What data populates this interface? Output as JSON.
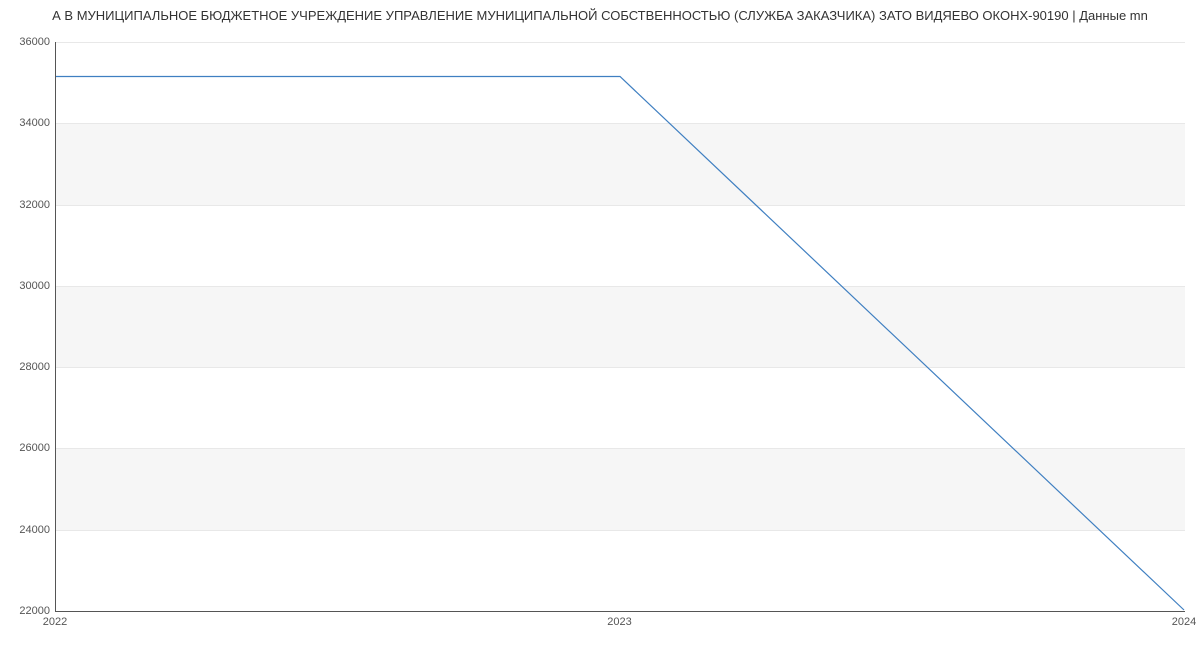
{
  "chart_data": {
    "type": "line",
    "title": "А В МУНИЦИПАЛЬНОЕ БЮДЖЕТНОЕ УЧРЕЖДЕНИЕ УПРАВЛЕНИЕ МУНИЦИПАЛЬНОЙ СОБСТВЕННОСТЬЮ (СЛУЖБА ЗАКАЗЧИКА) ЗАТО ВИДЯЕВО ОКОНХ-90190 | Данные mn",
    "xlabel": "",
    "ylabel": "",
    "x": [
      2022,
      2023,
      2024
    ],
    "values": [
      35150,
      35150,
      22000
    ],
    "x_ticks": [
      2022,
      2023,
      2024
    ],
    "y_ticks": [
      22000,
      24000,
      26000,
      28000,
      30000,
      32000,
      34000,
      36000
    ],
    "ylim": [
      22000,
      36000
    ],
    "xlim": [
      2022,
      2024
    ],
    "shaded_bands": true
  }
}
